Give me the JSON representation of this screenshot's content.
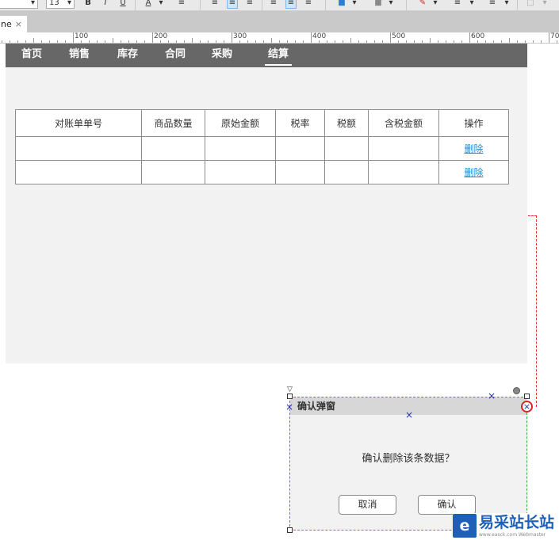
{
  "toolbar": {
    "font_size": "13",
    "bold": "B",
    "italic": "I",
    "underline": "U",
    "font_color": "A"
  },
  "tab": {
    "label": "ne",
    "close": "×"
  },
  "ruler": {
    "labels": [
      "100",
      "200",
      "300",
      "400",
      "500",
      "600",
      "700"
    ]
  },
  "nav": {
    "items": [
      "首页",
      "销售",
      "库存",
      "合同",
      "采购",
      "结算"
    ],
    "active": "结算"
  },
  "table": {
    "headers": [
      "对账单单号",
      "商品数量",
      "原始金额",
      "税率",
      "税额",
      "含税金额",
      "操作"
    ],
    "rows": [
      [
        "",
        "",
        "",
        "",
        "",
        "",
        "删除"
      ],
      [
        "",
        "",
        "",
        "",
        "",
        "",
        "删除"
      ]
    ]
  },
  "dialog": {
    "title": "确认弹窗",
    "message": "确认删除该条数据？",
    "cancel_label": "取消",
    "confirm_label": "确认"
  },
  "watermark": {
    "logo": "e",
    "text": "易采站长站",
    "sub": "www.easck.com  Webmaster"
  },
  "colors": {
    "nav_bg": "#676767",
    "panel_bg": "#f2f2f2",
    "link": "#1e8ad6",
    "dialog_border": "#3aaa3a",
    "connector": "#dd3333",
    "watermark_blue": "#1e5fb8"
  }
}
